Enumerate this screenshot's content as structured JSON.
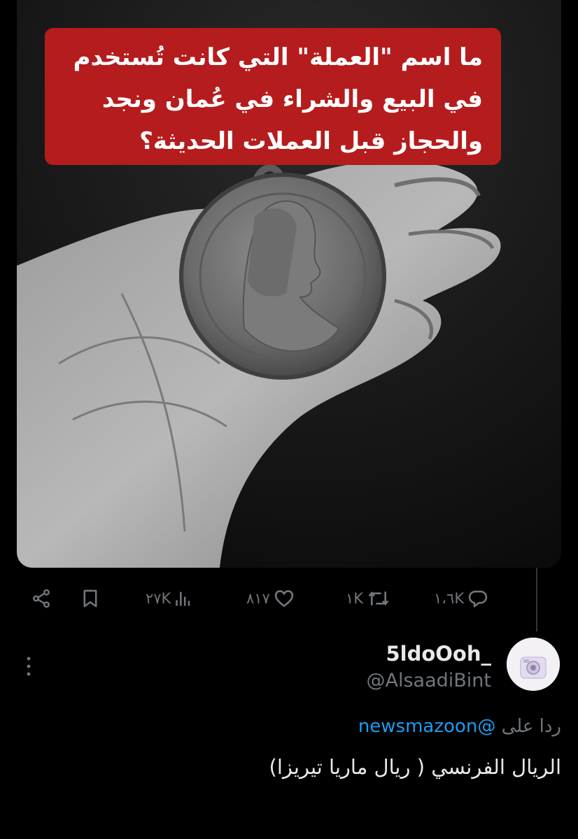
{
  "post": {
    "caption_lines": [
      "ما اسم \"العملة\" التي كانت تُستخدم",
      "في البيع والشراء في عُمان ونجد",
      "والحجاز قبل العملات الحديثة؟"
    ],
    "image": "hand holding Maria Theresa thaler silver coin"
  },
  "actions": {
    "replies": "١،٦K",
    "reposts": "١K",
    "likes": "٨١٧",
    "views": "٢٧K",
    "icons": [
      "reply-icon",
      "repost-icon",
      "like-icon",
      "views-icon",
      "bookmark-icon",
      "share-icon"
    ]
  },
  "reply": {
    "display_name": "5ldoOoh_",
    "handle": "@AlsaadiBint",
    "replying_prefix": "ردا على",
    "replying_to": "@newsmazoon",
    "text": "الريال الفرنسي ( ريال ماريا تيريزا)"
  },
  "colors": {
    "background": "#000000",
    "caption_bg": "#b51c1e",
    "muted": "#71767b",
    "link": "#1d9bf0",
    "text": "#e7e9ea"
  }
}
